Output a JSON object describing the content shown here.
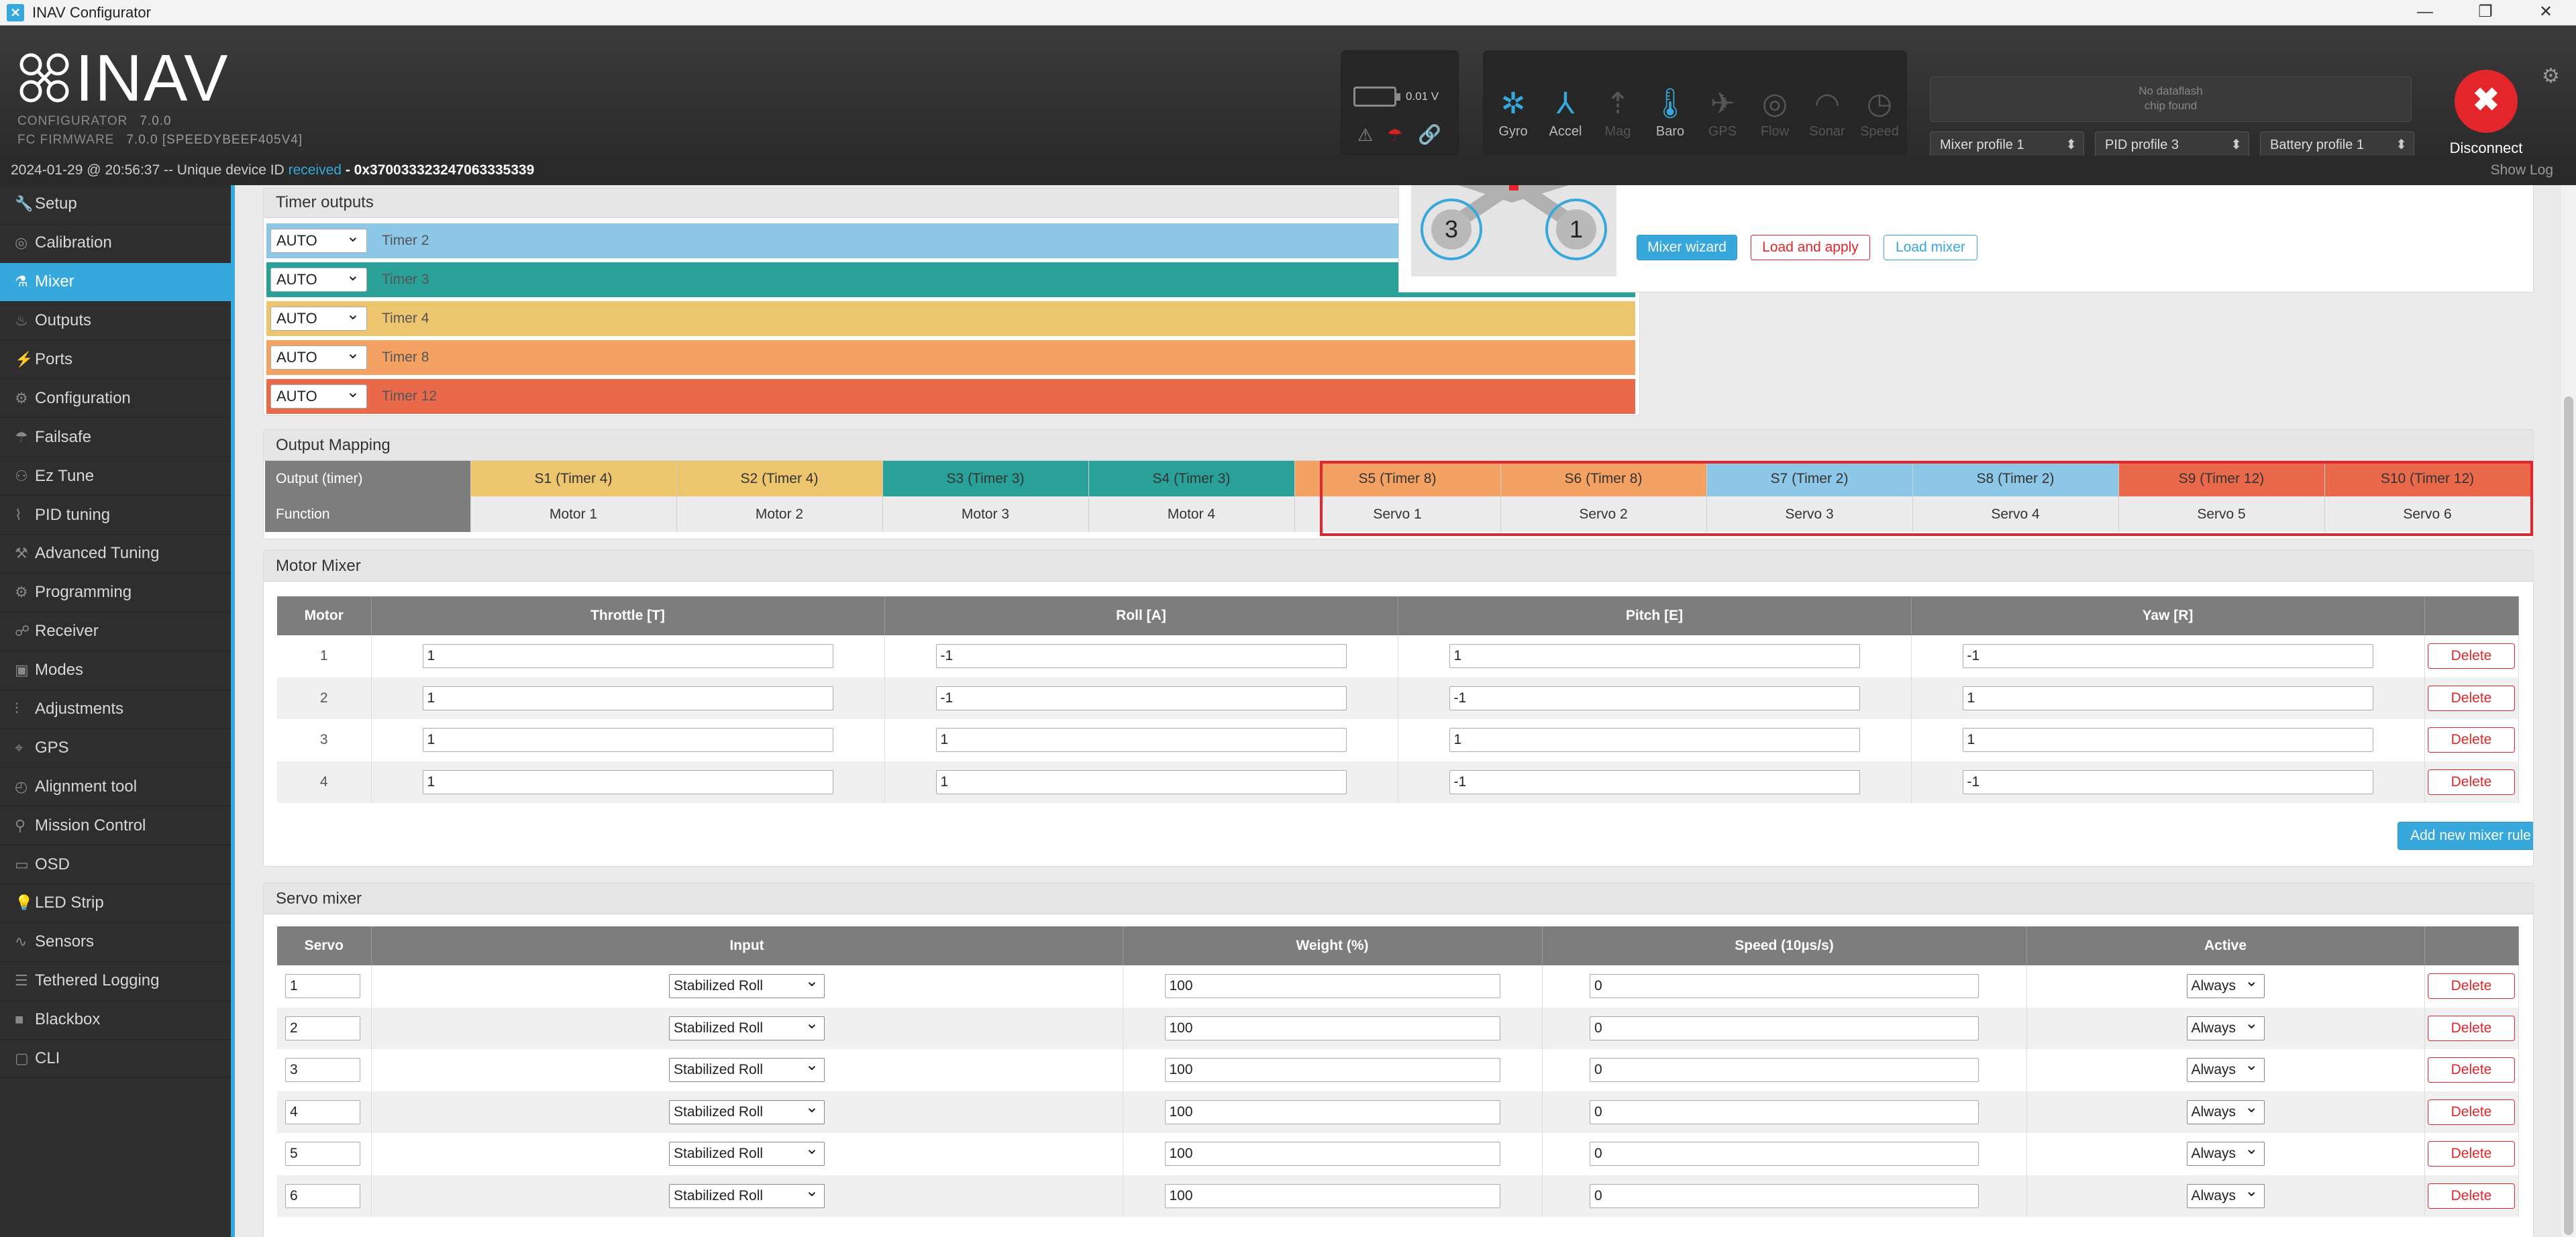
{
  "window": {
    "title": "INAV Configurator",
    "min": "—",
    "restore": "❐",
    "close": "✕"
  },
  "header": {
    "logo_text": "INAV",
    "configurator_label": "CONFIGURATOR",
    "configurator_version": "7.0.0",
    "firmware_label": "FC FIRMWARE",
    "firmware_version": "7.0.0 [SPEEDYBEEF405V4]",
    "battery_voltage": "0.01 V",
    "sensors": [
      {
        "name": "Gyro",
        "active": true
      },
      {
        "name": "Accel",
        "active": true
      },
      {
        "name": "Mag",
        "active": false
      },
      {
        "name": "Baro",
        "active": true
      },
      {
        "name": "GPS",
        "active": false
      },
      {
        "name": "Flow",
        "active": false
      },
      {
        "name": "Sonar",
        "active": false
      },
      {
        "name": "Speed",
        "active": false
      }
    ],
    "dataflash_line1": "No dataflash",
    "dataflash_line2": "chip found",
    "mixer_profile": "Mixer profile 1",
    "pid_profile": "PID profile 3",
    "battery_profile": "Battery profile 1",
    "disconnect_label": "Disconnect"
  },
  "status": {
    "timestamp": "2024-01-29 @ 20:56:37 -- Unique device ID",
    "received": "received",
    "device_id": "0x370033323247063335339",
    "show_log": "Show Log"
  },
  "sidebar": {
    "items": [
      {
        "label": "Setup",
        "icon": "wrench-icon"
      },
      {
        "label": "Calibration",
        "icon": "calibration-icon"
      },
      {
        "label": "Mixer",
        "icon": "mixer-icon",
        "active": true
      },
      {
        "label": "Outputs",
        "icon": "outputs-icon"
      },
      {
        "label": "Ports",
        "icon": "ports-icon"
      },
      {
        "label": "Configuration",
        "icon": "gear-icon"
      },
      {
        "label": "Failsafe",
        "icon": "parachute-icon"
      },
      {
        "label": "Ez Tune",
        "icon": "tune-icon"
      },
      {
        "label": "PID tuning",
        "icon": "pid-icon"
      },
      {
        "label": "Advanced Tuning",
        "icon": "advanced-tuning-icon"
      },
      {
        "label": "Programming",
        "icon": "programming-icon"
      },
      {
        "label": "Receiver",
        "icon": "receiver-icon"
      },
      {
        "label": "Modes",
        "icon": "modes-icon"
      },
      {
        "label": "Adjustments",
        "icon": "adjustments-icon"
      },
      {
        "label": "GPS",
        "icon": "gps-icon"
      },
      {
        "label": "Alignment tool",
        "icon": "alignment-icon"
      },
      {
        "label": "Mission Control",
        "icon": "map-pin-icon"
      },
      {
        "label": "OSD",
        "icon": "osd-icon"
      },
      {
        "label": "LED Strip",
        "icon": "led-icon"
      },
      {
        "label": "Sensors",
        "icon": "sensors-icon"
      },
      {
        "label": "Tethered Logging",
        "icon": "logging-icon"
      },
      {
        "label": "Blackbox",
        "icon": "blackbox-icon"
      },
      {
        "label": "CLI",
        "icon": "cli-icon"
      }
    ]
  },
  "timer_outputs": {
    "title": "Timer outputs",
    "rows": [
      {
        "value": "AUTO",
        "label": "Timer 2",
        "color": "#8dc7e7"
      },
      {
        "value": "AUTO",
        "label": "Timer 3",
        "color": "#2aa198"
      },
      {
        "value": "AUTO",
        "label": "Timer 4",
        "color": "#ecc56e"
      },
      {
        "value": "AUTO",
        "label": "Timer 8",
        "color": "#f4a263"
      },
      {
        "value": "AUTO",
        "label": "Timer 12",
        "color": "#e9694a"
      }
    ]
  },
  "preview": {
    "motor_left": "3",
    "motor_right": "1",
    "mixer_wizard": "Mixer wizard",
    "load_and_apply": "Load and apply",
    "load_mixer": "Load mixer"
  },
  "output_mapping": {
    "title": "Output Mapping",
    "row1_label": "Output (timer)",
    "row2_label": "Function",
    "columns": [
      {
        "output": "S1 (Timer 4)",
        "function": "Motor 1",
        "color": "#ecc56e"
      },
      {
        "output": "S2 (Timer 4)",
        "function": "Motor 2",
        "color": "#ecc56e"
      },
      {
        "output": "S3 (Timer 3)",
        "function": "Motor 3",
        "color": "#2aa198"
      },
      {
        "output": "S4 (Timer 3)",
        "function": "Motor 4",
        "color": "#2aa198"
      },
      {
        "output": "S5 (Timer 8)",
        "function": "Servo 1",
        "color": "#f4a263"
      },
      {
        "output": "S6 (Timer 8)",
        "function": "Servo 2",
        "color": "#f4a263"
      },
      {
        "output": "S7 (Timer 2)",
        "function": "Servo 3",
        "color": "#8dc7e7"
      },
      {
        "output": "S8 (Timer 2)",
        "function": "Servo 4",
        "color": "#8dc7e7"
      },
      {
        "output": "S9 (Timer 12)",
        "function": "Servo 5",
        "color": "#e9694a"
      },
      {
        "output": "S10 (Timer 12)",
        "function": "Servo 6",
        "color": "#e9694a"
      }
    ]
  },
  "motor_mixer": {
    "title": "Motor Mixer",
    "headers": [
      "Motor",
      "Throttle [T]",
      "Roll [A]",
      "Pitch [E]",
      "Yaw [R]"
    ],
    "rows": [
      {
        "motor": "1",
        "throttle": "1",
        "roll": "-1",
        "pitch": "1",
        "yaw": "-1"
      },
      {
        "motor": "2",
        "throttle": "1",
        "roll": "-1",
        "pitch": "-1",
        "yaw": "1"
      },
      {
        "motor": "3",
        "throttle": "1",
        "roll": "1",
        "pitch": "1",
        "yaw": "1"
      },
      {
        "motor": "4",
        "throttle": "1",
        "roll": "1",
        "pitch": "-1",
        "yaw": "-1"
      }
    ],
    "delete_label": "Delete",
    "add_label": "Add new mixer rule"
  },
  "servo_mixer": {
    "title": "Servo mixer",
    "headers": [
      "Servo",
      "Input",
      "Weight (%)",
      "Speed (10µs/s)",
      "Active"
    ],
    "rows": [
      {
        "servo": "1",
        "input": "Stabilized Roll",
        "weight": "100",
        "speed": "0",
        "active": "Always"
      },
      {
        "servo": "2",
        "input": "Stabilized Roll",
        "weight": "100",
        "speed": "0",
        "active": "Always"
      },
      {
        "servo": "3",
        "input": "Stabilized Roll",
        "weight": "100",
        "speed": "0",
        "active": "Always"
      },
      {
        "servo": "4",
        "input": "Stabilized Roll",
        "weight": "100",
        "speed": "0",
        "active": "Always"
      },
      {
        "servo": "5",
        "input": "Stabilized Roll",
        "weight": "100",
        "speed": "0",
        "active": "Always"
      },
      {
        "servo": "6",
        "input": "Stabilized Roll",
        "weight": "100",
        "speed": "0",
        "active": "Always"
      }
    ],
    "delete_label": "Delete"
  },
  "colors": {
    "accent": "#37a8db",
    "danger": "#e2262b",
    "highlight_box": "#e2262b"
  }
}
